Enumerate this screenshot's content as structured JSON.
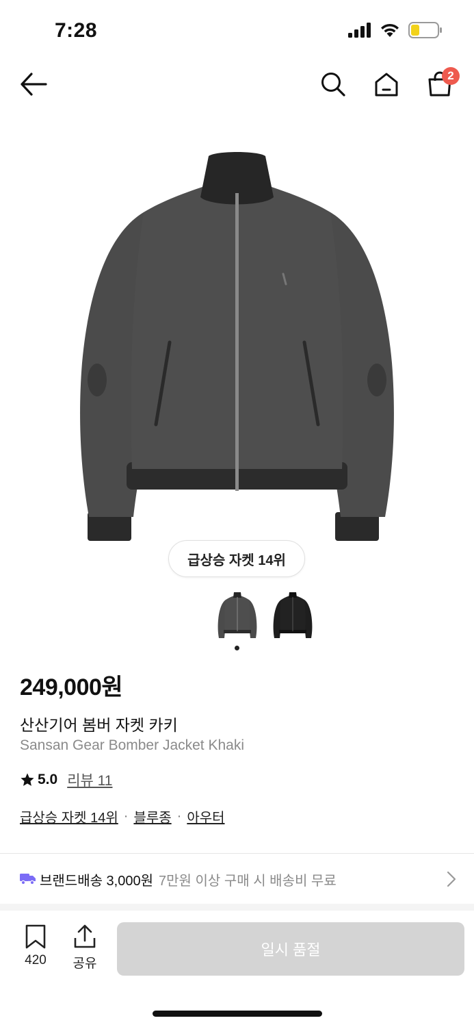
{
  "status_bar": {
    "time": "7:28"
  },
  "nav": {
    "cart_count": "2",
    "icons": [
      "back-arrow-icon",
      "search-icon",
      "home-icon",
      "shopping-bag-icon"
    ]
  },
  "product": {
    "rank_chip": "급상승 자켓 14위",
    "price": "249,000원",
    "name_ko": "산산기어 봄버 자켓 카키",
    "name_en": "Sansan Gear Bomber Jacket Khaki",
    "rating": "5.0",
    "review_label": "리뷰 11",
    "tags": [
      "급상승 자켓 14위",
      "블루종",
      "아우터"
    ],
    "thumbnail_count": 2,
    "selected_thumbnail": 1
  },
  "delivery": {
    "main": "브랜드배송 3,000원",
    "sub": "7만원 이상 구매 시 배송비 무료"
  },
  "bottom_bar": {
    "bookmark_count": "420",
    "share_label": "공유",
    "cta_label": "일시 품절"
  },
  "colors": {
    "badge": "#ee5a4e",
    "delivery_truck": "#7b6cf6",
    "cta_disabled": "#d4d4d4",
    "battery": "#f2d21b"
  }
}
